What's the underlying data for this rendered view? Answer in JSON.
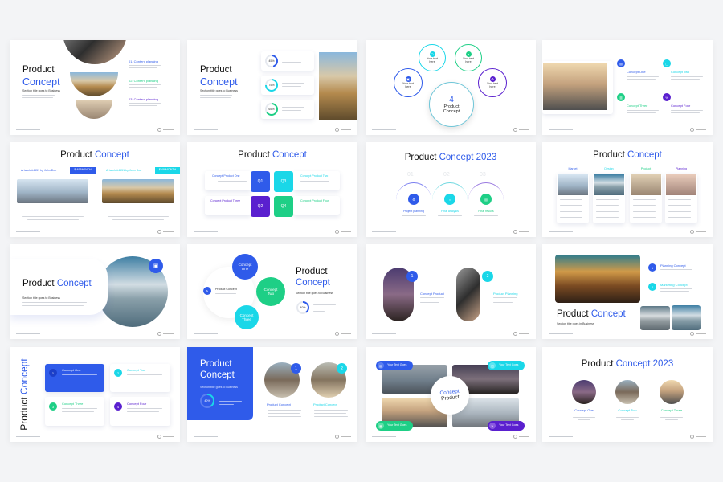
{
  "colors": {
    "blue": "#2f5bea",
    "cyan": "#1ad7e8",
    "green": "#1ecf86",
    "purple": "#5a20cf",
    "background": "#f3f4f6"
  },
  "slides": [
    {
      "title_a": "Product",
      "title_b": "Concept",
      "subtitle": "Section title goes to Business",
      "items": [
        "01. Content planning",
        "02. Content planning",
        "03. Content planning"
      ]
    },
    {
      "title_a": "Product",
      "title_b": "Concept",
      "subtitle": "Section title goes to Business",
      "stats": [
        "45%",
        "75%",
        "65%"
      ],
      "stat_values": [
        45,
        75,
        65
      ]
    },
    {
      "center_number": "4",
      "center_a": "Product",
      "center_b": "Concept",
      "bubbles": [
        "Your text here",
        "Your text here",
        "Your text here",
        "Your text here"
      ]
    },
    {
      "concepts": [
        "Concept One",
        "Concept Two",
        "Concept Three",
        "Concept Four"
      ]
    },
    {
      "title_a": "Product",
      "title_b": "Concept",
      "labels": [
        "Artwork #4651 by John Doe",
        "Artwork #4651 by John Doe"
      ],
      "prices": [
        "$ 49/MONTH",
        "$ 49/MONTH"
      ]
    },
    {
      "title_a": "Product",
      "title_b": "Concept",
      "quads": [
        "Q1",
        "Q3",
        "Q2",
        "Q4"
      ],
      "cards": [
        "Concept Product One",
        "Concept Product Two",
        "Concept Product Three",
        "Concept Product Four"
      ]
    },
    {
      "title_a": "Product",
      "title_b": "Concept 2023",
      "numbers": [
        "01",
        "02",
        "03"
      ],
      "steps": [
        "Project planning",
        "Final analysis",
        "Final results"
      ]
    },
    {
      "title_a": "Product",
      "title_b": "Concept",
      "columns": [
        "Market",
        "Design",
        "Product",
        "Planning"
      ]
    },
    {
      "title_a": "Product",
      "title_b": "Concept",
      "subtitle": "Section title goes to Business"
    },
    {
      "title_a": "Product",
      "title_b": "Concept",
      "subtitle": "Section title goes to Business",
      "side_label": "Product Concept",
      "circles": [
        "Concept One",
        "Concept Two",
        "Concept Three"
      ],
      "stat": "40%",
      "stat_value": 40
    },
    {
      "badges": [
        "1",
        "2"
      ],
      "labels": [
        "Concept Product",
        "Product Planning"
      ]
    },
    {
      "title_a": "Product",
      "title_b": "Concept",
      "subtitle": "Section title goes in Business",
      "badges": [
        "1",
        "2"
      ],
      "items": [
        "Planning Concept",
        "Marketing Concept"
      ]
    },
    {
      "title_a": "Product",
      "title_b": "Concept",
      "badges": [
        "1",
        "2",
        "3",
        "4"
      ],
      "cards": [
        "Concept One",
        "Concept Two",
        "Concept Three",
        "Concept Four"
      ]
    },
    {
      "title_a": "Product",
      "title_b": "Concept",
      "subtitle": "Section title goes to Business",
      "stat": "40%",
      "stat_value": 40,
      "badges": [
        "1",
        "2"
      ],
      "labels": [
        "Product Concept",
        "Product Concept"
      ]
    },
    {
      "center_a": "Concept",
      "center_b": "Product",
      "tags": [
        "Your Text Goes",
        "Your Text Goes",
        "Your Text Goes",
        "Your Text Goes"
      ]
    },
    {
      "title_a": "Product",
      "title_b": "Concept 2023",
      "concepts": [
        "Concept One",
        "Concept Two",
        "Concept Three"
      ]
    }
  ]
}
